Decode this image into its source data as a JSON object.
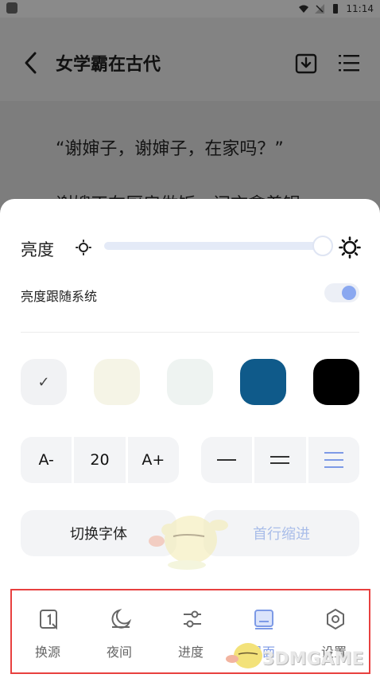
{
  "status_bar": {
    "time": "11:14"
  },
  "header": {
    "title": "女学霸在古代"
  },
  "reading": {
    "paragraph1": "“谢婶子，谢婶子，在家吗？”",
    "paragraph2": "谢嫂正在厨房做饭，闻言拿着锅"
  },
  "brightness": {
    "label": "亮度",
    "level": 0.99,
    "follow_system_label": "亮度跟随系统",
    "follow_system_on": true
  },
  "themes": [
    {
      "color": "#f1f2f4",
      "selected": true,
      "check": "✓"
    },
    {
      "color": "#f5f4e6",
      "selected": false
    },
    {
      "color": "#eef3f1",
      "selected": false
    },
    {
      "color": "#0f5a8a",
      "selected": false
    },
    {
      "color": "#000000",
      "selected": false
    }
  ],
  "font_size": {
    "decrease": "A-",
    "value": "20",
    "increase": "A+"
  },
  "line_spacing": {
    "options": [
      "compact",
      "normal",
      "loose"
    ],
    "selected": "loose"
  },
  "buttons": {
    "switch_font": "切换字体",
    "first_line_indent": "首行缩进"
  },
  "bottom_nav": [
    {
      "label": "换源",
      "icon": "switch-source-icon"
    },
    {
      "label": "夜间",
      "icon": "moon-icon"
    },
    {
      "label": "进度",
      "icon": "progress-sliders-icon"
    },
    {
      "label": "界面",
      "icon": "interface-icon",
      "active": true
    },
    {
      "label": "设置",
      "icon": "gear-icon"
    }
  ],
  "watermark": "3DMGAME",
  "colors": {
    "accent": "#7d9ae6",
    "highlight_border": "#e8403f"
  }
}
